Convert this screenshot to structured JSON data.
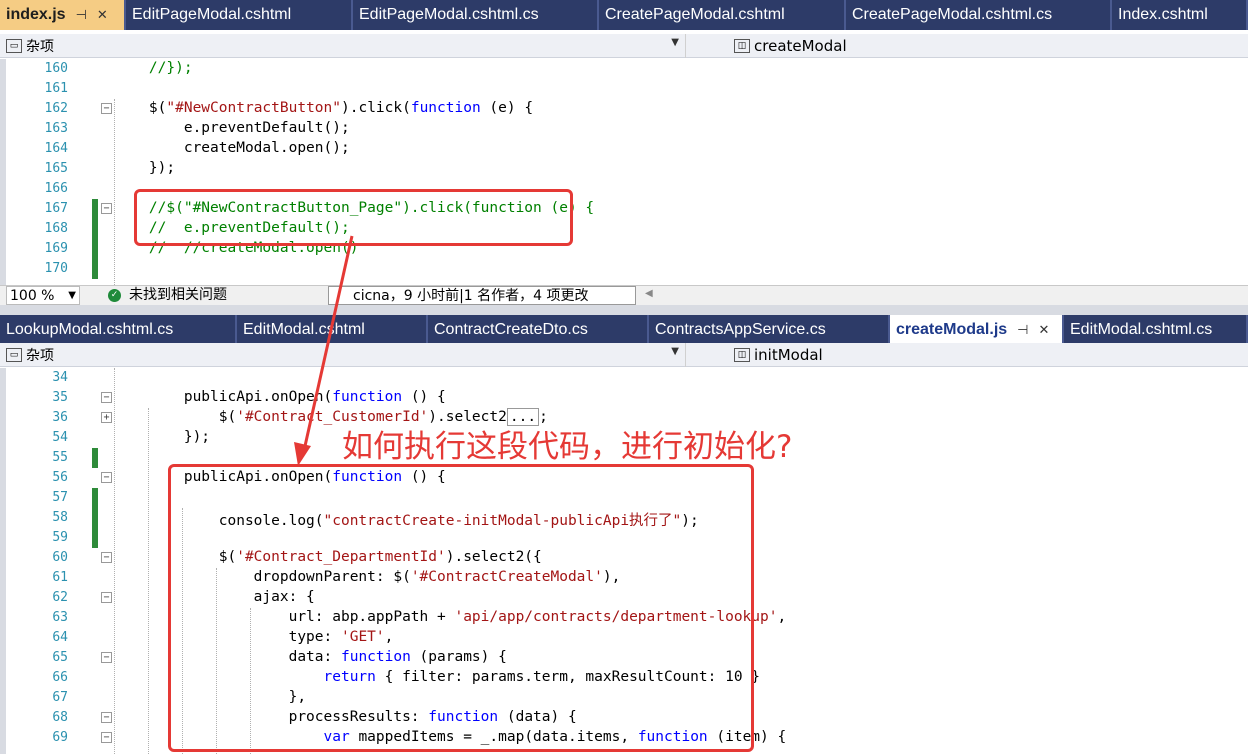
{
  "top": {
    "tabs": [
      {
        "label": "index.js",
        "state": "active"
      },
      {
        "label": "EditPageModal.cshtml"
      },
      {
        "label": "EditPageModal.cshtml.cs"
      },
      {
        "label": "CreatePageModal.cshtml"
      },
      {
        "label": "CreatePageModal.cshtml.cs"
      },
      {
        "label": "Index.cshtml"
      }
    ],
    "nav_left": "杂项",
    "nav_right": "createModal",
    "lines": [
      {
        "n": "160",
        "code": [
          [
            "cm",
            "    //});"
          ]
        ]
      },
      {
        "n": "161",
        "code": []
      },
      {
        "n": "162",
        "code": [
          [
            "",
            "    $("
          ],
          [
            "str",
            "\"#NewContractButton\""
          ],
          [
            "",
            ").click("
          ],
          [
            "kw",
            "function"
          ],
          [
            "",
            " (e) {"
          ]
        ]
      },
      {
        "n": "163",
        "code": [
          [
            "",
            "        e.preventDefault();"
          ]
        ]
      },
      {
        "n": "164",
        "code": [
          [
            "",
            "        createModal.open();"
          ]
        ]
      },
      {
        "n": "165",
        "code": [
          [
            "",
            "    });"
          ]
        ]
      },
      {
        "n": "166",
        "code": []
      },
      {
        "n": "167",
        "code": [
          [
            "cm",
            "    //$(\"#NewContractButton_Page\").click(function (e) {"
          ]
        ]
      },
      {
        "n": "168",
        "code": [
          [
            "cm",
            "    //  e.preventDefault();"
          ]
        ]
      },
      {
        "n": "169",
        "code": [
          [
            "cm",
            "    //  //createModal.open()"
          ]
        ]
      },
      {
        "n": "170",
        "code": []
      }
    ]
  },
  "status": {
    "zoom": "100 %",
    "issues": "未找到相关问题",
    "author": "cicna，9 小时前|1 名作者，4 项更改"
  },
  "bottom": {
    "tabs": [
      {
        "label": "LookupModal.cshtml.cs"
      },
      {
        "label": "EditModal.cshtml"
      },
      {
        "label": "ContractCreateDto.cs"
      },
      {
        "label": "ContractsAppService.cs"
      },
      {
        "label": "createModal.js",
        "state": "selected"
      },
      {
        "label": "EditModal.cshtml.cs"
      }
    ],
    "nav_left": "杂项",
    "nav_right": "initModal",
    "lines": [
      {
        "n": "34",
        "code": []
      },
      {
        "n": "35",
        "code": [
          [
            "",
            "        publicApi.onOpen("
          ],
          [
            "kw",
            "function"
          ],
          [
            "",
            " () {"
          ]
        ]
      },
      {
        "n": "36",
        "code": [
          [
            "",
            "            $("
          ],
          [
            "str",
            "'#Contract_CustomerId'"
          ],
          [
            "",
            ").select2"
          ],
          [
            "",
            "..."
          ],
          [
            "",
            ";"
          ]
        ]
      },
      {
        "n": "54",
        "code": [
          [
            "",
            "        });"
          ]
        ]
      },
      {
        "n": "55",
        "code": []
      },
      {
        "n": "56",
        "code": [
          [
            "",
            "        publicApi.onOpen("
          ],
          [
            "kw",
            "function"
          ],
          [
            "",
            " () {"
          ]
        ]
      },
      {
        "n": "57",
        "code": []
      },
      {
        "n": "58",
        "code": [
          [
            "",
            "            console.log("
          ],
          [
            "str",
            "\"contractCreate-initModal-publicApi执行了\""
          ],
          [
            "",
            ");"
          ]
        ]
      },
      {
        "n": "59",
        "code": []
      },
      {
        "n": "60",
        "code": [
          [
            "",
            "            $("
          ],
          [
            "str",
            "'#Contract_DepartmentId'"
          ],
          [
            "",
            ").select2({"
          ]
        ]
      },
      {
        "n": "61",
        "code": [
          [
            "",
            "                dropdownParent: $("
          ],
          [
            "str",
            "'#ContractCreateModal'"
          ],
          [
            "",
            "),"
          ]
        ]
      },
      {
        "n": "62",
        "code": [
          [
            "",
            "                ajax: {"
          ]
        ]
      },
      {
        "n": "63",
        "code": [
          [
            "",
            "                    url: abp.appPath + "
          ],
          [
            "str",
            "'api/app/contracts/department-lookup'"
          ],
          [
            "",
            ","
          ]
        ]
      },
      {
        "n": "64",
        "code": [
          [
            "",
            "                    type: "
          ],
          [
            "str",
            "'GET'"
          ],
          [
            "",
            ","
          ]
        ]
      },
      {
        "n": "65",
        "code": [
          [
            "",
            "                    data: "
          ],
          [
            "kw",
            "function"
          ],
          [
            "",
            " (params) {"
          ]
        ]
      },
      {
        "n": "66",
        "code": [
          [
            "",
            "                        "
          ],
          [
            "kw",
            "return"
          ],
          [
            "",
            " { filter: params.term, maxResultCount: 10 }"
          ]
        ]
      },
      {
        "n": "67",
        "code": [
          [
            "",
            "                    },"
          ]
        ]
      },
      {
        "n": "68",
        "code": [
          [
            "",
            "                    processResults: "
          ],
          [
            "kw",
            "function"
          ],
          [
            "",
            " (data) {"
          ]
        ]
      },
      {
        "n": "69",
        "code": [
          [
            "",
            "                        "
          ],
          [
            "kw",
            "var"
          ],
          [
            "",
            " mappedItems = _.map(data.items, "
          ],
          [
            "kw",
            "function"
          ],
          [
            "",
            " (item) {"
          ]
        ]
      }
    ]
  },
  "annotation": "如何执行这段代码，进行初始化?",
  "colors": {
    "annotation": "#e53935",
    "keyword": "#0000ff",
    "string": "#a31515",
    "comment": "#008000",
    "linenum": "#2b91af"
  }
}
